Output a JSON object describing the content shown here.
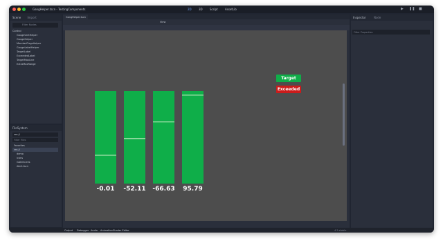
{
  "window": {
    "title": "GangHelper.tscn - TestingComponents",
    "top_tabs": [
      "2D",
      "3D",
      "Script",
      "AssetLib"
    ]
  },
  "scene_panel": {
    "tabs": [
      "Scene",
      "Import"
    ],
    "filter_placeholder": "Filter Nodes",
    "nodes": [
      {
        "label": "Control"
      },
      {
        "label": "GaugeUnitHelper"
      },
      {
        "label": "GaugeHelper"
      },
      {
        "label": "MemberFlagsHelper"
      },
      {
        "label": "GaugeLabelHelper"
      },
      {
        "label": "TargetLabel"
      },
      {
        "label": "ExceededLabel"
      },
      {
        "label": "TargetMaxLine"
      },
      {
        "label": "ExtraMaxRange"
      }
    ]
  },
  "filesystem_panel": {
    "tab": "FileSystem",
    "path": "res://",
    "filter_placeholder": "Filter Files",
    "items": [
      "Favorites",
      "res://",
      "demo",
      "icons",
      "GAInfo.tres",
      "Alert.tscn"
    ]
  },
  "editor": {
    "tab_label": "GangHelper.tscn",
    "toolbar_view": "View"
  },
  "inspector": {
    "tabs": [
      "Inspector",
      "Node"
    ],
    "filter_placeholder": "Filter Properties"
  },
  "bottom_tabs": [
    "Output",
    "Debugger",
    "Audio",
    "Animation",
    "Shader Editor"
  ],
  "version": "4.2.stable",
  "chart_data": {
    "type": "bar",
    "bars": [
      {
        "label": "-0.01",
        "marker": 0.31
      },
      {
        "label": "-52.11",
        "marker": 0.49
      },
      {
        "label": "-66.63",
        "marker": 0.67
      },
      {
        "label": "95.79",
        "marker": 0.96
      }
    ],
    "legend": [
      {
        "label": "Target",
        "color": "#0fae49"
      },
      {
        "label": "Exceeded",
        "color": "#cc1b1b"
      }
    ]
  }
}
